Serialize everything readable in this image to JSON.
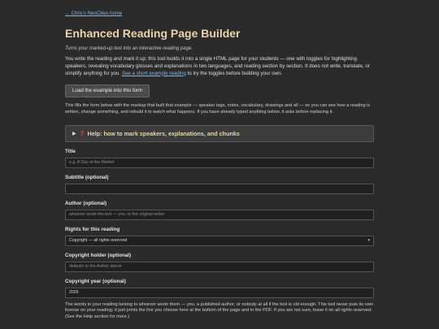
{
  "nav": {
    "back_label": "← Chris's NeoCities home"
  },
  "header": {
    "title": "Enhanced Reading Page Builder",
    "tagline": "Turns your marked-up text into an interactive reading page."
  },
  "intro": {
    "text": "You write the reading and mark it up; this tool builds it into a single HTML page for your students — one with toggles for highlighting speakers, revealing vocabulary glosses and explanations in two languages, and reading section by section. It does not write, translate, or simplify anything for you.",
    "link_label": "See a short example reading",
    "link_suffix": "to try the toggles before building your own."
  },
  "load_example": {
    "button_label": "Load the example into this form",
    "note": "This fills the form below with the markup that built that example — speaker tags, notes, vocabulary, drawings and all — so you can see how a reading is written, change something, and rebuild it to watch what happens. If you have already typed anything below, it asks before replacing it."
  },
  "help": {
    "label": "Help: how to mark speakers, explanations, and chunks"
  },
  "form": {
    "title": {
      "label": "Title",
      "placeholder": "e.g. A Day at the Market"
    },
    "subtitle": {
      "label": "Subtitle (optional)",
      "placeholder": ""
    },
    "author": {
      "label": "Author (optional)",
      "placeholder": "whoever wrote the text — you, or the original writer"
    },
    "rights": {
      "label": "Rights for this reading",
      "selected": "Copyright — all rights reserved"
    },
    "holder": {
      "label": "Copyright holder (optional)",
      "placeholder": "defaults to the Author above"
    },
    "year": {
      "label": "Copyright year (optional)",
      "value": "2026"
    }
  },
  "rights_note": {
    "text": "The words in your reading belong to whoever wrote them — you, a published author, or nobody at all if the text is old enough. This tool never puts its own license on your reading; it just prints the line you choose here at the bottom of the page and in the PDF. If you are not sure, leave it on",
    "emphasis": "all rights reserved",
    "suffix": ". (See the Help section for more.)"
  },
  "colors": {
    "background": "#2b2b2b",
    "heading": "#e8d4a8",
    "link": "#8ab4d8",
    "help_icon": "#d94a3d"
  },
  "icons": {
    "disclosure": "triangle-right-icon",
    "help": "question-mark-icon",
    "select_caret": "chevron-down-icon"
  }
}
